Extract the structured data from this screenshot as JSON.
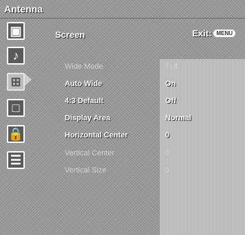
{
  "header": {
    "title": "Antenna"
  },
  "screen_menu": {
    "section_title": "Screen",
    "exit_label": "Exit:",
    "exit_badge": "MENU"
  },
  "sidebar": {
    "icons": [
      {
        "name": "picture-icon",
        "glyph": "▣"
      },
      {
        "name": "sound-icon",
        "glyph": "♪"
      },
      {
        "name": "screen-icon",
        "glyph": "⊞",
        "selected": true
      },
      {
        "name": "channel-icon",
        "glyph": "□"
      },
      {
        "name": "lock-icon",
        "glyph": "🔒"
      },
      {
        "name": "setup-icon",
        "glyph": "☰"
      }
    ]
  },
  "settings": [
    {
      "label": "Wide Mode",
      "value": "Full",
      "enabled": false
    },
    {
      "label": "Auto Wide",
      "value": "On",
      "enabled": true
    },
    {
      "label": "4:3 Default",
      "value": "Off",
      "enabled": true
    },
    {
      "label": "Display Area",
      "value": "Normal",
      "enabled": true
    },
    {
      "label": "Horizontal Center",
      "value": "0",
      "enabled": true
    },
    {
      "label": "Vertical Center",
      "value": "0",
      "enabled": false
    },
    {
      "label": "Vertical Size",
      "value": "0",
      "enabled": false
    }
  ]
}
